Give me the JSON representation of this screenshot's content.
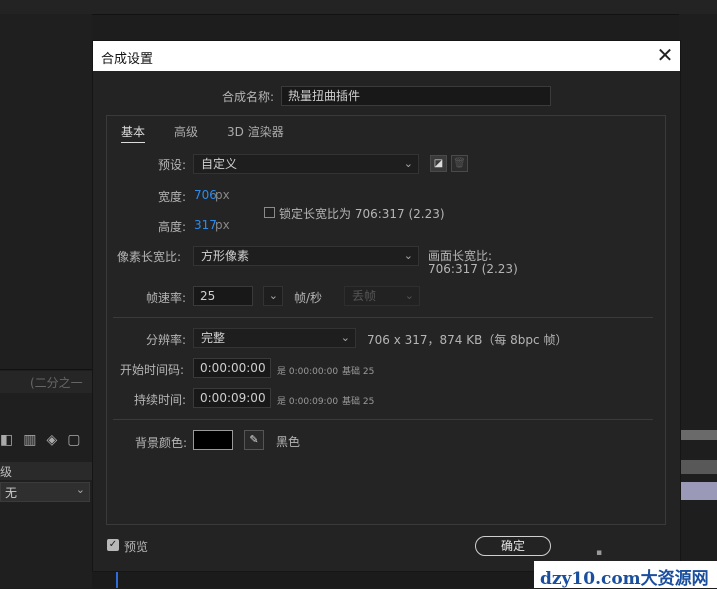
{
  "background": {
    "panel_tab_text": "(二分之一",
    "layer_header": "级",
    "blend_value": "无"
  },
  "dialog": {
    "title": "合成设置",
    "comp_name_label": "合成名称:",
    "comp_name_value": "热量扭曲插件",
    "tabs": [
      {
        "label": "基本"
      },
      {
        "label": "高级"
      },
      {
        "label": "3D 渲染器"
      }
    ],
    "preset_label": "预设:",
    "preset_value": "自定义",
    "width_label": "宽度:",
    "width_value": "706",
    "width_unit": "px",
    "height_label": "高度:",
    "height_value": "317",
    "height_unit": "px",
    "lock_label": "锁定长宽比为 706:317 (2.23)",
    "pixel_aspect_label": "像素长宽比:",
    "pixel_aspect_value": "方形像素",
    "frame_aspect_label": "画面长宽比:",
    "frame_aspect_value": "706:317 (2.23)",
    "frame_rate_label": "帧速率:",
    "frame_rate_value": "25",
    "fps_unit": "帧/秒",
    "drop_frame_value": "丢帧",
    "resolution_label": "分辨率:",
    "resolution_value": "完整",
    "resolution_info": "706 x 317，874 KB（每 8bpc 帧）",
    "start_timecode_label": "开始时间码:",
    "start_timecode_value": "0:00:00:00",
    "start_timecode_eq": "是 0:00:00:00",
    "start_timecode_base": "基础 25",
    "duration_label": "持续时间:",
    "duration_value": "0:00:09:00",
    "duration_eq": "是 0:00:09:00",
    "duration_base": "基础 25",
    "bg_color_label": "背景颜色:",
    "bg_color_name": "黑色",
    "bg_color_hex": "#000000",
    "preview_label": "预览",
    "ok_label": "确定"
  },
  "watermark": "dzy10.com大资源网",
  "colors": {
    "accent_blue": "#2d8ceb",
    "dialog_bg": "#232323",
    "titlebar_bg": "#ffffff"
  }
}
